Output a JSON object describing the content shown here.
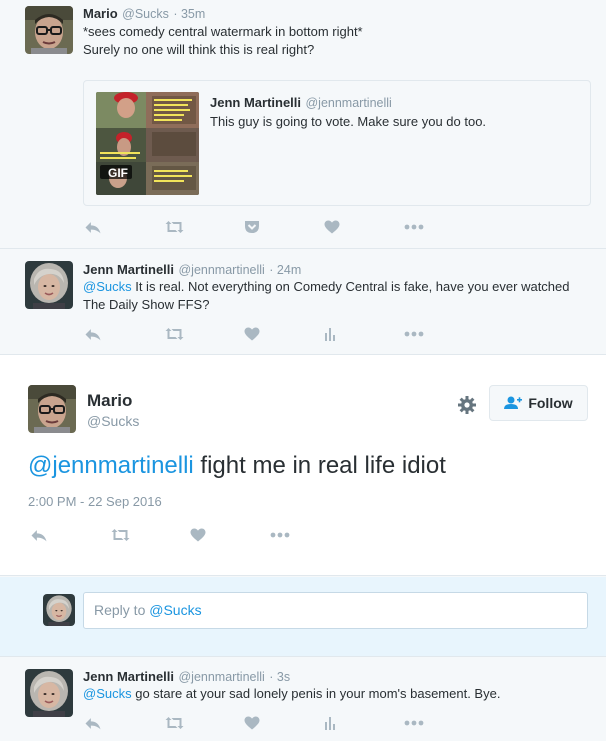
{
  "tweet1": {
    "name": "Mario",
    "handle": "@Sucks",
    "time": "· 35m",
    "line1": "*sees comedy central watermark in bottom right*",
    "line2": "Surely no one will think this is real right?",
    "quote": {
      "name": "Jenn Martinelli",
      "handle": "@jennmartinelli",
      "text": "This guy is going to vote. Make sure you do too.",
      "gif_badge": "GIF"
    }
  },
  "tweet2": {
    "name": "Jenn Martinelli",
    "handle": "@jennmartinelli",
    "time": "· 24m",
    "mention": "@Sucks",
    "text": " It is real. Not everything on Comedy Central is fake, have you ever watched The Daily Show FFS?"
  },
  "main": {
    "name": "Mario",
    "handle": "@Sucks",
    "follow_label": "Follow",
    "mention": "@jennmartinelli",
    "text": " fight me in real life idiot",
    "timestamp": "2:00 PM - 22 Sep 2016"
  },
  "reply_box": {
    "prefix": "Reply to ",
    "mention": "@Sucks"
  },
  "tweet3": {
    "name": "Jenn Martinelli",
    "handle": "@jennmartinelli",
    "time": "· 3s",
    "mention": "@Sucks",
    "text": " go stare at your sad lonely penis in your mom's basement. Bye."
  },
  "colors": {
    "link": "#1b95e0",
    "muted": "#8899a6",
    "icon": "#aab8c2",
    "follow_blue": "#1b95e0"
  },
  "icons": [
    "reply-icon",
    "retweet-icon",
    "pocket-icon",
    "like-icon",
    "more-icon",
    "analytics-icon",
    "gear-icon",
    "follow-user-icon"
  ]
}
